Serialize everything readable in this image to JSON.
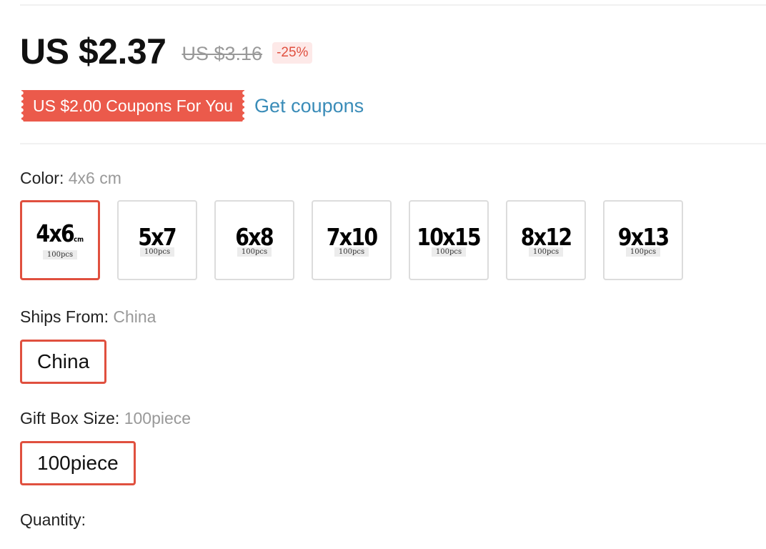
{
  "price": {
    "current": "US $2.37",
    "original": "US $3.16",
    "discount": "-25%"
  },
  "coupon": {
    "tag": "US $2.00 Coupons For You",
    "link": "Get coupons"
  },
  "color": {
    "label": "Color: ",
    "value": "4x6 cm",
    "swatches": [
      {
        "main": "4x6",
        "unit": "cm",
        "sub": "100pcs",
        "selected": true
      },
      {
        "main": "5x7",
        "sub": "100pcs"
      },
      {
        "main": "6x8",
        "sub": "100pcs"
      },
      {
        "main": "7x10",
        "sub": "100pcs"
      },
      {
        "main": "10x15",
        "sub": "100pcs"
      },
      {
        "main": "8x12",
        "sub": "100pcs"
      },
      {
        "main": "9x13",
        "sub": "100pcs"
      }
    ]
  },
  "ships_from": {
    "label": "Ships From: ",
    "value": "China",
    "option": "China"
  },
  "gift_box": {
    "label": "Gift Box Size: ",
    "value": "100piece",
    "option": "100piece"
  },
  "quantity": {
    "label": "Quantity:"
  },
  "colors": {
    "accent": "#e0503f",
    "coupon_bg": "#eb5a4b",
    "link": "#3a8cb8"
  }
}
